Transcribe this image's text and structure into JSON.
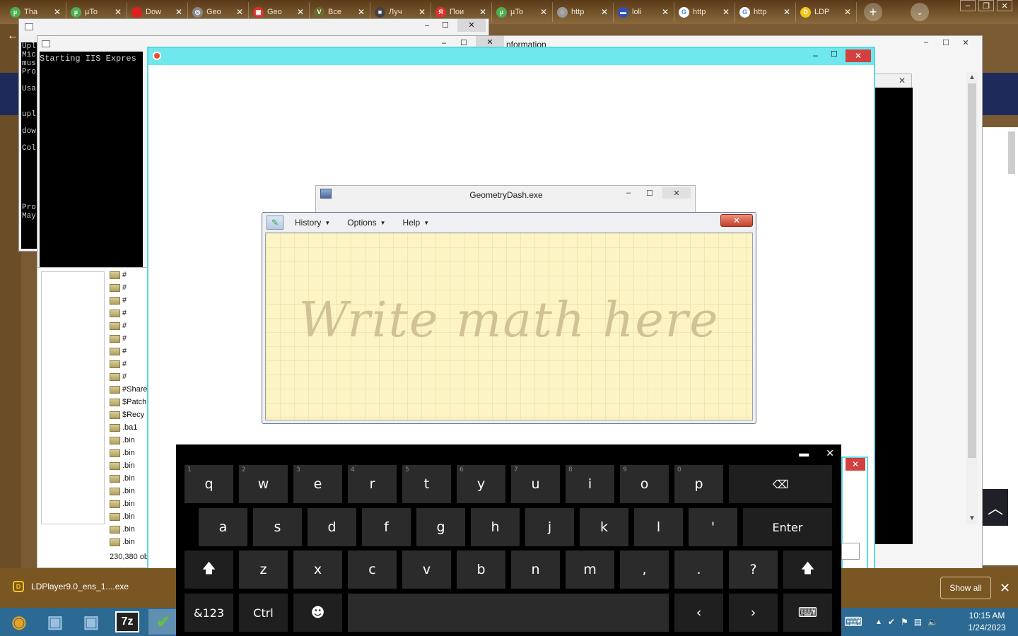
{
  "browser": {
    "tabs": [
      {
        "label": "Tha",
        "icon": "utorrent-icon",
        "color": "#4caf50",
        "glyph": "µ"
      },
      {
        "label": "µTo",
        "icon": "utorrent-icon",
        "color": "#4caf50",
        "glyph": "µ"
      },
      {
        "label": "Dow",
        "icon": "download-site-icon",
        "color": "#e02020",
        "glyph": ""
      },
      {
        "label": "Geo",
        "icon": "globe-icon",
        "color": "#888888",
        "glyph": "◎"
      },
      {
        "label": "Geo",
        "icon": "ghost-icon",
        "color": "#e03030",
        "glyph": "▣"
      },
      {
        "label": "Все",
        "icon": "vk-icon",
        "color": "#6a6a2a",
        "glyph": "V"
      },
      {
        "label": "Луч",
        "icon": "cube-icon",
        "color": "#444444",
        "glyph": "■"
      },
      {
        "label": "Пои",
        "icon": "yandex-icon",
        "color": "#e03030",
        "glyph": "Я"
      },
      {
        "label": "µTo",
        "icon": "utorrent-icon",
        "color": "#4caf50",
        "glyph": "µ"
      },
      {
        "label": "http",
        "icon": "loading-icon",
        "color": "#9a9a9a",
        "glyph": "○"
      },
      {
        "label": "loli",
        "icon": "flag-icon",
        "color": "#3050c0",
        "glyph": "▬"
      },
      {
        "label": "http",
        "icon": "google-icon",
        "color": "#ffffff",
        "glyph": "G"
      },
      {
        "label": "http",
        "icon": "google-icon",
        "color": "#ffffff",
        "glyph": "G"
      },
      {
        "label": "LDP",
        "icon": "ldplayer-icon",
        "color": "#f5c518",
        "glyph": "D"
      }
    ],
    "new_tab": "+",
    "download": {
      "filename": "LDPlayer9.0_ens_1....exe",
      "show_all": "Show all",
      "close": "✕"
    }
  },
  "console": {
    "left_lines": [
      "Upl",
      "Mic",
      "mus",
      "Pro",
      "",
      "Usa",
      "",
      "",
      "upl",
      "",
      "dow",
      "",
      "Col",
      "",
      "",
      "",
      "",
      "",
      "",
      "Pro",
      "May"
    ],
    "main_text": "Starting IIS Expres"
  },
  "explorer": {
    "folders": [
      "#",
      "#",
      "#",
      "#",
      "#",
      "#",
      "#",
      "#",
      "#",
      "#Share",
      "$Patch",
      "$Recy",
      ".ba1",
      ".bin",
      ".bin",
      ".bin",
      ".bin",
      ".bin",
      ".bin",
      ".bin",
      ".bin",
      ".bin",
      ".bin"
    ],
    "status": "230,380 ob"
  },
  "info_window": {
    "title": "nformation"
  },
  "gd_window": {
    "title": "GeometryDash.exe"
  },
  "math_panel": {
    "menu": [
      "History",
      "Options",
      "Help"
    ],
    "hint": "Write math here",
    "close": "✕"
  },
  "keyboard": {
    "row1": [
      [
        "q",
        "1"
      ],
      [
        "w",
        "2"
      ],
      [
        "e",
        "3"
      ],
      [
        "r",
        "4"
      ],
      [
        "t",
        "5"
      ],
      [
        "y",
        "6"
      ],
      [
        "u",
        "7"
      ],
      [
        "i",
        "8"
      ],
      [
        "o",
        "9"
      ],
      [
        "p",
        "0"
      ]
    ],
    "row2": [
      "a",
      "s",
      "d",
      "f",
      "g",
      "h",
      "j",
      "k",
      "l",
      "'"
    ],
    "row3": [
      "z",
      "x",
      "c",
      "v",
      "b",
      "n",
      "m",
      ",",
      ".",
      "?"
    ],
    "backspace": "⌫",
    "enter": "Enter",
    "shift": "🡅",
    "sym": "&123",
    "ctrl": "Ctrl",
    "emoji": "☻",
    "left": "‹",
    "right": "›",
    "kbd": "⌨",
    "dock": "▬",
    "close": "✕"
  },
  "taskbar": {
    "time": "10:15 AM",
    "date": "1/24/2023",
    "pinned": [
      {
        "name": "chrome-icon",
        "glyph": "◉",
        "color": "#e8a020"
      },
      {
        "name": "remote-desktop-icon",
        "glyph": "▣",
        "color": "#9ac0e0"
      },
      {
        "name": "remote-desktop-icon-2",
        "glyph": "▣",
        "color": "#9ac0e0"
      },
      {
        "name": "7zip-icon",
        "glyph": "7z",
        "color": "#ffffff"
      },
      {
        "name": "math-input-icon",
        "glyph": "✔",
        "color": "#60c040"
      }
    ]
  }
}
